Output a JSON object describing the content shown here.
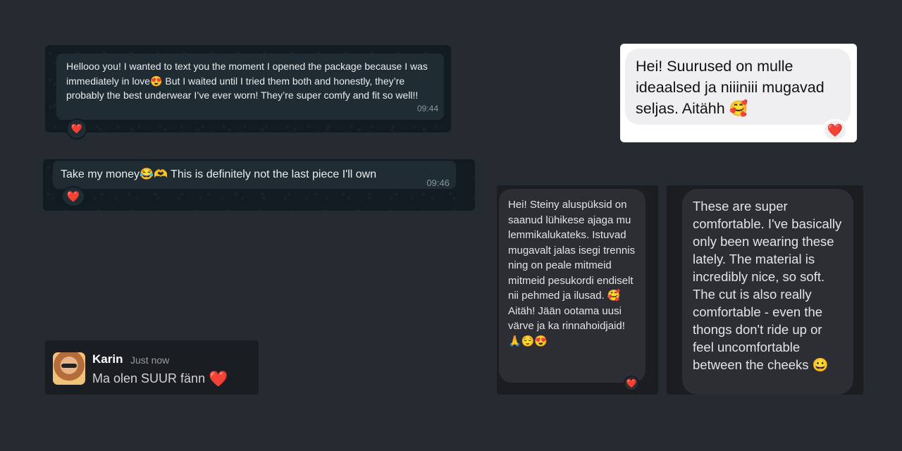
{
  "whatsapp_message_1": {
    "text": "Hellooo you! I wanted to text you the moment I opened the package because I was immediately in love😍 But I waited until I tried them both and honestly, they’re probably the best underwear I’ve ever worn! They’re super comfy and fit so well!!",
    "time": "09:44",
    "reaction": "❤️"
  },
  "whatsapp_message_2": {
    "text": "Take my money😂🫶 This is definitely not the last piece I'll own",
    "time": "09:46",
    "reaction": "❤️"
  },
  "imessage_light": {
    "text": "Hei! Suurused on mulle ideaalsed ja niiiniii mugavad seljas. Aitähh 🥰",
    "reaction": "❤️"
  },
  "slack_message": {
    "name": "Karin",
    "time": "Just now",
    "text": "Ma olen SUUR fänn",
    "emoji": "❤️"
  },
  "dm_estonian": {
    "text": "Hei! Steiny aluspüksid on saanud lühikese ajaga mu lemmikalukateks. Istuvad mugavalt jalas isegi trennis ning on peale mitmeid mitmeid pesukordi endiselt nii pehmed ja ilusad. 🥰 Aitäh! Jään ootama uusi värve ja ka rinnahoidjaid! 🙏😌😍",
    "reaction": "❤️"
  },
  "dm_english": {
    "text": "These are super comfortable. I've basically only been wearing these lately. The material is incredibly nice, so soft. The cut is also really comfortable - even the thongs don't ride up or feel uncomfortable between the cheeks 😀"
  },
  "colors": {
    "background": "#262a31",
    "whatsapp_panel": "#111b21",
    "whatsapp_bubble": "#202c33",
    "heart": "#e8284b"
  }
}
